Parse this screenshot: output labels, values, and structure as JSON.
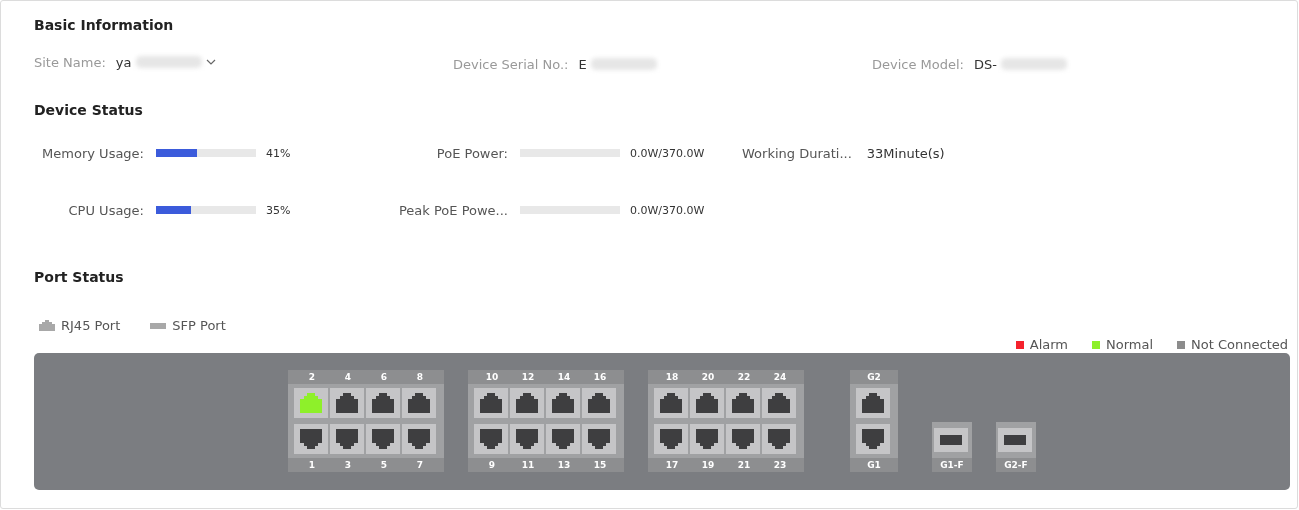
{
  "basic_information": {
    "title": "Basic Information",
    "fields": [
      {
        "label": "Site Name:",
        "value": "ya",
        "redacted": true,
        "dropdown": true
      },
      {
        "label": "Device Serial No.:",
        "value": "E",
        "redacted": true
      },
      {
        "label": "Device Model:",
        "value": "DS-",
        "redacted": true
      }
    ]
  },
  "device_status": {
    "title": "Device Status",
    "metrics": [
      {
        "kind": "bar",
        "label": "Memory Usage:",
        "level": 0.41,
        "reading": "41%"
      },
      {
        "kind": "bar",
        "label": "PoE Power:",
        "level": 0,
        "reading": "0.0W/370.0W"
      },
      {
        "kind": "text",
        "label": "Working Durati...",
        "reading": "33Minute(s)"
      },
      {
        "kind": "bar",
        "label": "CPU Usage:",
        "level": 0.35,
        "reading": "35%"
      },
      {
        "kind": "bar",
        "label": "Peak PoE Powe...",
        "level": 0,
        "reading": "0.0W/370.0W"
      }
    ]
  },
  "port_status": {
    "title": "Port Status",
    "port_types": [
      {
        "kind": "rj45",
        "label": "RJ45 Port"
      },
      {
        "kind": "sfp",
        "label": "SFP Port"
      }
    ],
    "legend": [
      {
        "label": "Alarm",
        "color": "#f5222d"
      },
      {
        "label": "Normal",
        "color": "#8ef02a"
      },
      {
        "label": "Not Connected",
        "color": "#8c8c8c"
      }
    ],
    "groups": [
      {
        "kind": "rj45",
        "top": [
          {
            "label": "2",
            "color": "#8ef02a"
          },
          {
            "label": "4",
            "color": "#3e3e40"
          },
          {
            "label": "6",
            "color": "#3e3e40"
          },
          {
            "label": "8",
            "color": "#3e3e40"
          }
        ],
        "bottom": [
          {
            "label": "1",
            "color": "#3e3e40"
          },
          {
            "label": "3",
            "color": "#3e3e40"
          },
          {
            "label": "5",
            "color": "#3e3e40"
          },
          {
            "label": "7",
            "color": "#3e3e40"
          }
        ]
      },
      {
        "kind": "rj45",
        "top": [
          {
            "label": "10",
            "color": "#3e3e40"
          },
          {
            "label": "12",
            "color": "#3e3e40"
          },
          {
            "label": "14",
            "color": "#3e3e40"
          },
          {
            "label": "16",
            "color": "#3e3e40"
          }
        ],
        "bottom": [
          {
            "label": "9",
            "color": "#3e3e40"
          },
          {
            "label": "11",
            "color": "#3e3e40"
          },
          {
            "label": "13",
            "color": "#3e3e40"
          },
          {
            "label": "15",
            "color": "#3e3e40"
          }
        ]
      },
      {
        "kind": "rj45",
        "top": [
          {
            "label": "18",
            "color": "#3e3e40"
          },
          {
            "label": "20",
            "color": "#3e3e40"
          },
          {
            "label": "22",
            "color": "#3e3e40"
          },
          {
            "label": "24",
            "color": "#3e3e40"
          }
        ],
        "bottom": [
          {
            "label": "17",
            "color": "#3e3e40"
          },
          {
            "label": "19",
            "color": "#3e3e40"
          },
          {
            "label": "21",
            "color": "#3e3e40"
          },
          {
            "label": "23",
            "color": "#3e3e40"
          }
        ]
      },
      {
        "kind": "rj45",
        "top": [
          {
            "label": "G2",
            "color": "#3e3e40"
          }
        ],
        "bottom": [
          {
            "label": "G1",
            "color": "#3e3e40"
          }
        ]
      },
      {
        "kind": "sfp",
        "bottom": [
          {
            "label": "G1-F",
            "color": "#3e3e40"
          }
        ]
      },
      {
        "kind": "sfp",
        "bottom": [
          {
            "label": "G2-F",
            "color": "#3e3e40"
          }
        ]
      }
    ]
  }
}
